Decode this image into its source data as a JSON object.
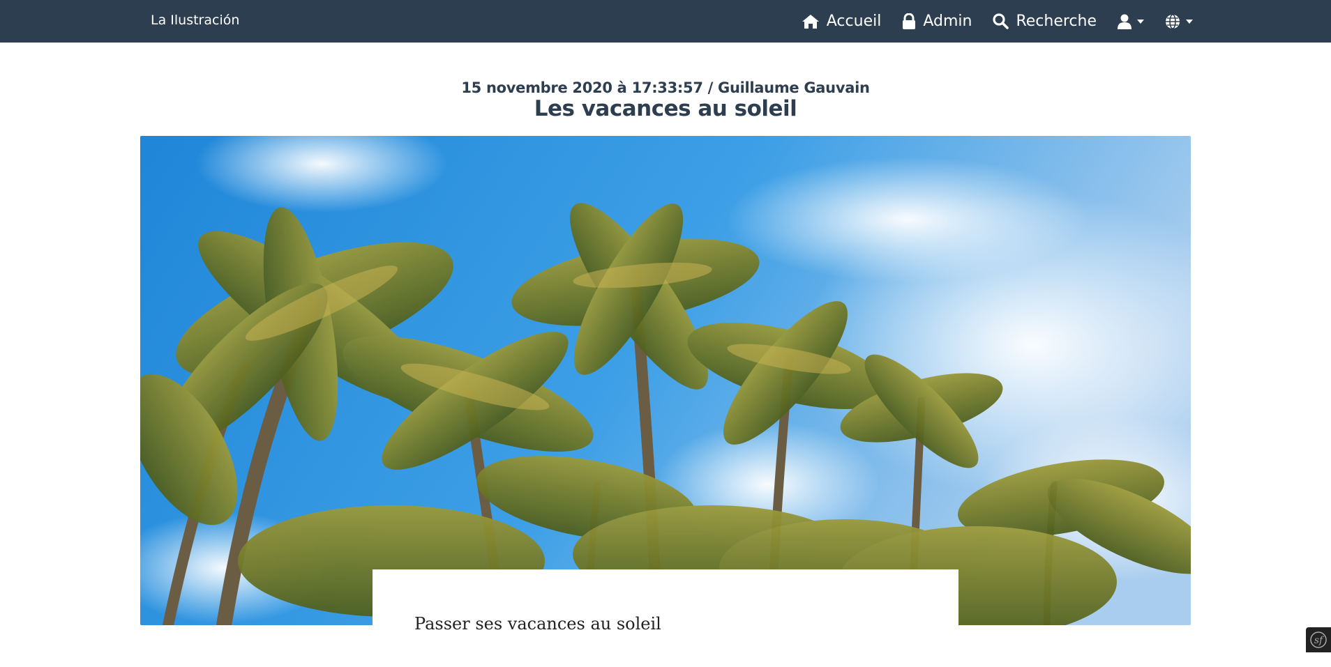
{
  "brand": "La Ilustración",
  "nav": {
    "home": "Accueil",
    "admin": "Admin",
    "search": "Recherche"
  },
  "icons": {
    "home": "home-icon",
    "admin": "lock-icon",
    "search": "search-icon",
    "user": "user-icon",
    "language": "globe-icon",
    "debug": "symfony-icon"
  },
  "article": {
    "meta": "15 novembre 2020 à 17:33:57 / Guillaume Gauvain",
    "title": "Les vacances au soleil",
    "excerpt": "Passer ses vacances au soleil"
  },
  "colors": {
    "navbar": "#2c3e50",
    "heading": "#2c3e50",
    "sky": "#2b8fde"
  }
}
